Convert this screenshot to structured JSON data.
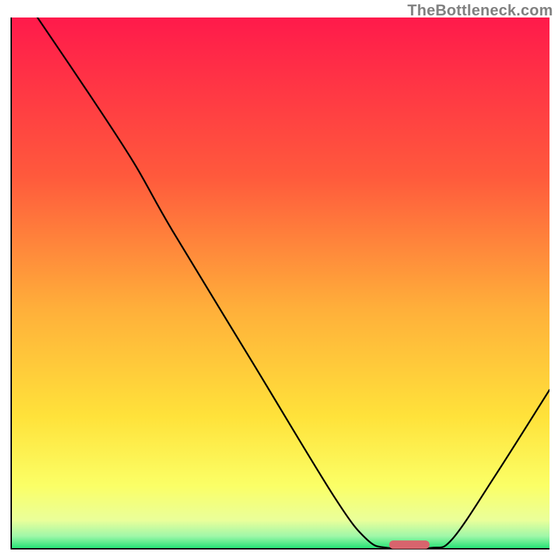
{
  "watermark": "TheBottleneck.com",
  "chart_data": {
    "type": "line",
    "title": "",
    "xlabel": "",
    "ylabel": "",
    "xlim": [
      0,
      100
    ],
    "ylim": [
      0,
      100
    ],
    "gradient_stops": [
      {
        "offset": 0,
        "color": "#ff1a4b"
      },
      {
        "offset": 0.3,
        "color": "#ff5a3c"
      },
      {
        "offset": 0.55,
        "color": "#ffb03a"
      },
      {
        "offset": 0.75,
        "color": "#ffe23a"
      },
      {
        "offset": 0.88,
        "color": "#fbff66"
      },
      {
        "offset": 0.945,
        "color": "#eaff9a"
      },
      {
        "offset": 0.975,
        "color": "#9ff7a8"
      },
      {
        "offset": 1.0,
        "color": "#18e070"
      }
    ],
    "series": [
      {
        "name": "bottleneck-curve",
        "points": [
          {
            "x": 5.0,
            "y": 100.0
          },
          {
            "x": 15.0,
            "y": 85.0
          },
          {
            "x": 23.0,
            "y": 72.5
          },
          {
            "x": 30.0,
            "y": 60.0
          },
          {
            "x": 45.0,
            "y": 35.0
          },
          {
            "x": 60.0,
            "y": 10.0
          },
          {
            "x": 66.0,
            "y": 2.0
          },
          {
            "x": 70.0,
            "y": 0.3
          },
          {
            "x": 78.0,
            "y": 0.3
          },
          {
            "x": 82.0,
            "y": 2.0
          },
          {
            "x": 90.0,
            "y": 14.0
          },
          {
            "x": 100.0,
            "y": 30.0
          }
        ]
      }
    ],
    "marker": {
      "name": "optimal-range",
      "x_center": 74.0,
      "y": 0.9,
      "width": 7.5,
      "color": "#d8646d"
    },
    "axes": {
      "left": {
        "x": 0,
        "y0": 0,
        "y1": 100
      },
      "bottom": {
        "y": 0,
        "x0": 0,
        "x1": 100
      }
    }
  }
}
